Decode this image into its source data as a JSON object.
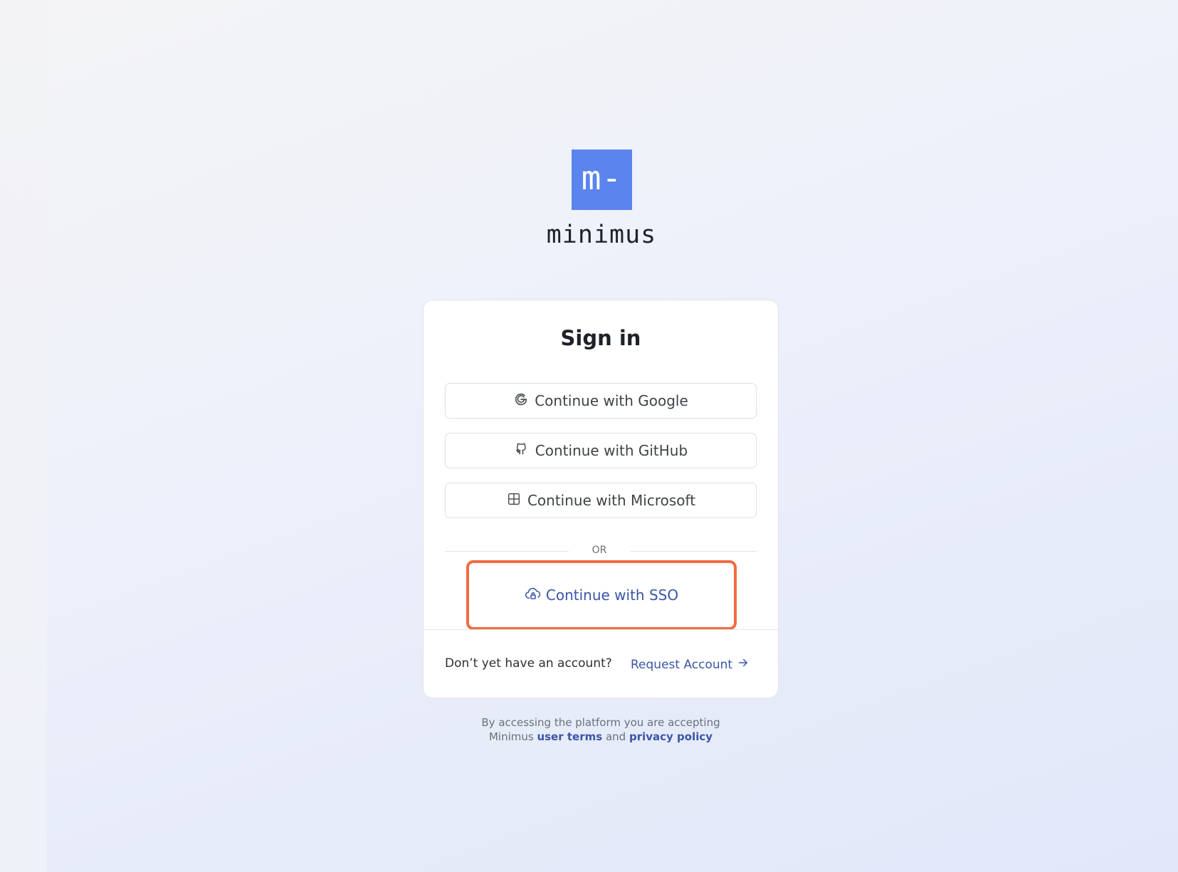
{
  "brand": {
    "logo_mark": "m-",
    "name": "minimus",
    "logo_color": "#5b84ee"
  },
  "signin": {
    "title": "Sign in",
    "providers": [
      {
        "label": "Continue with Google",
        "icon": "google-icon"
      },
      {
        "label": "Continue with GitHub",
        "icon": "github-icon"
      },
      {
        "label": "Continue with Microsoft",
        "icon": "microsoft-icon"
      }
    ],
    "divider_text": "OR",
    "sso": {
      "label": "Continue with SSO",
      "icon": "cloud-lock-icon",
      "highlight_color": "#f26b43"
    }
  },
  "footer": {
    "prompt": "Don’t yet have an account?",
    "request_label": "Request Account",
    "request_icon": "arrow-right-icon"
  },
  "legal": {
    "line1": "By accessing the platform you are accepting",
    "prefix": "Minimus",
    "terms": "user terms",
    "and": "and",
    "privacy": "privacy policy"
  },
  "colors": {
    "accent_link": "#3a56a6"
  }
}
